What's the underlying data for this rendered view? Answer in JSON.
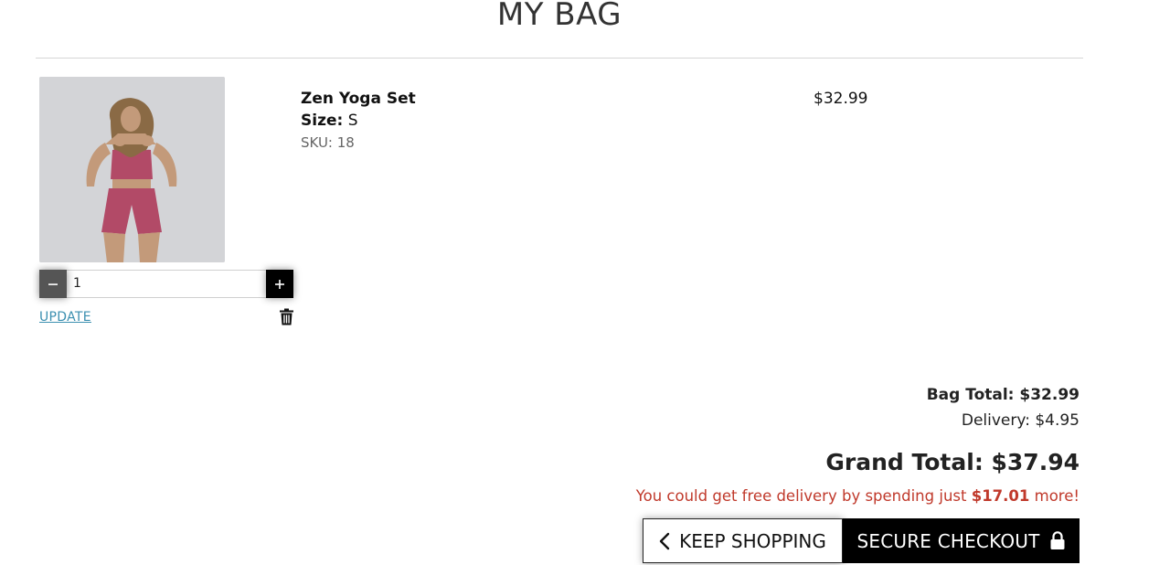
{
  "page": {
    "title": "MY BAG"
  },
  "item": {
    "name": "Zen Yoga Set",
    "size_label": "Size:",
    "size_value": "S",
    "sku": "SKU: 18",
    "price": "$32.99",
    "quantity": "1",
    "update_label": "UPDATE",
    "image_icon": "product-photo",
    "minus_icon": "minus-icon",
    "plus_icon": "plus-icon",
    "remove_icon": "trash-icon"
  },
  "summary": {
    "bag_total": "Bag Total: $32.99",
    "delivery": "Delivery: $4.95",
    "grand_total": "Grand Total: $37.94",
    "free_delivery_prefix": "You could get free delivery by spending just ",
    "free_delivery_amount": "$17.01",
    "free_delivery_suffix": " more!"
  },
  "actions": {
    "keep_shopping_label": "KEEP SHOPPING",
    "keep_shopping_icon": "chevron-left-icon",
    "checkout_label": "SECURE CHECKOUT",
    "checkout_icon": "lock-icon"
  },
  "colors": {
    "accent_link": "#3b8fb0",
    "free_delivery_text": "#c0392b",
    "checkout_bg": "#000000"
  }
}
